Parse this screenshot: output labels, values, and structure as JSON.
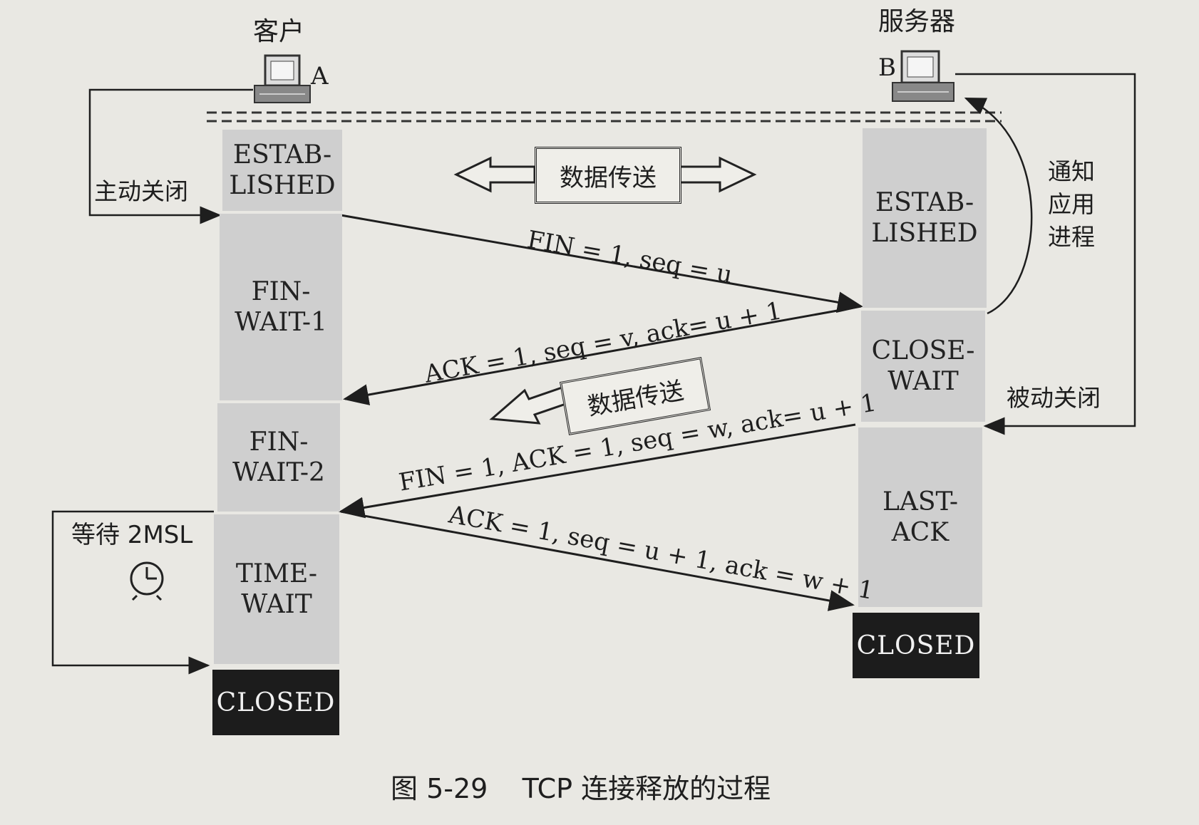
{
  "client": {
    "title": "客户",
    "letter": "A",
    "active_close": "主动关闭",
    "wait": "等待 2MSL"
  },
  "server": {
    "title": "服务器",
    "letter": "B",
    "notify": "通知\n应用\n进程",
    "passive_close": "被动关闭"
  },
  "client_states": [
    "ESTAB-\nLISHED",
    "FIN-\nWAIT-1",
    "FIN-\nWAIT-2",
    "TIME-\nWAIT",
    "CLOSED"
  ],
  "server_states": [
    "ESTAB-\nLISHED",
    "CLOSE-\nWAIT",
    "LAST-\nACK",
    "CLOSED"
  ],
  "data_transfer": "数据传送",
  "data_transfer_2": "数据传送",
  "messages": [
    "FIN = 1, seq = u",
    "ACK = 1, seq = v, ack= u + 1",
    "FIN = 1, ACK = 1, seq = w, ack= u + 1",
    "ACK = 1, seq = u + 1, ack = w + 1"
  ],
  "caption": "图 5-29    TCP 连接释放的过程"
}
